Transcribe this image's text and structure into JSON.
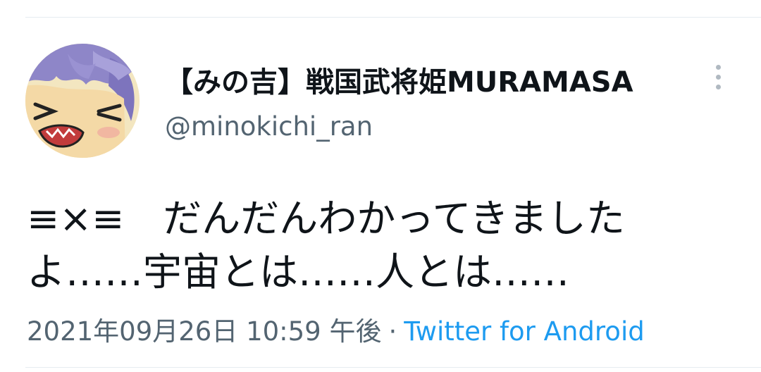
{
  "tweet": {
    "display_name": "【みの吉】戦国武将姫MURAMASA",
    "handle": "@minokichi_ran",
    "text": "≡×≡　だんだんわかってきましたよ……宇宙とは……人とは……",
    "timestamp": "2021年09月26日 10:59 午後",
    "separator": "·",
    "source": "Twitter for Android"
  },
  "icons": {
    "more": "more-vertical-icon",
    "avatar": "anime-character-avatar"
  },
  "colors": {
    "text": "#0f1419",
    "secondary": "#536471",
    "link": "#1d9bf0",
    "divider": "#e6ecf0"
  }
}
